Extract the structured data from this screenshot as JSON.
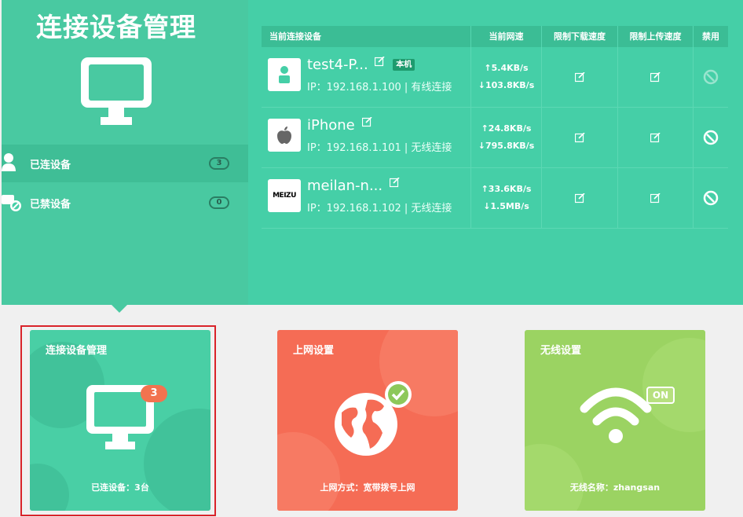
{
  "panel": {
    "title": "连接设备管理",
    "side_items": [
      {
        "label": "已连设备",
        "count": "3"
      },
      {
        "label": "已禁设备",
        "count": "0"
      }
    ]
  },
  "table": {
    "headers": [
      "当前连接设备",
      "当前网速",
      "限制下载速度",
      "限制上传速度",
      "禁用"
    ],
    "rows": [
      {
        "name": "test4-P...",
        "tag": "本机",
        "ip": "IP：192.168.1.100 | 有线连接",
        "up": "5.4KB/s",
        "down": "103.8KB/s",
        "avatar_icon": "person-icon",
        "disabled_dim": true
      },
      {
        "name": "iPhone",
        "tag": "",
        "ip": "IP：192.168.1.101 | 无线连接",
        "up": "24.8KB/s",
        "down": "795.8KB/s",
        "avatar_icon": "apple-icon",
        "disabled_dim": false
      },
      {
        "name": "meilan-n...",
        "tag": "",
        "ip": "IP：192.168.1.102 | 无线连接",
        "up": "33.6KB/s",
        "down": "1.5MB/s",
        "avatar_icon": "meizu-logo",
        "avatar_text": "MEIZU",
        "disabled_dim": false
      }
    ]
  },
  "cards": [
    {
      "title": "连接设备管理",
      "footer": "已连设备：3台",
      "badge": "3",
      "color": "#49cfa5"
    },
    {
      "title": "上网设置",
      "footer": "上网方式：宽带拨号上网",
      "color": "#f56c55"
    },
    {
      "title": "无线设置",
      "footer": "无线名称：zhangsan",
      "badge": "ON",
      "color": "#9bd362"
    }
  ],
  "colors": {
    "accent": "#45cfa7",
    "selected_frame": "#d9232a"
  }
}
